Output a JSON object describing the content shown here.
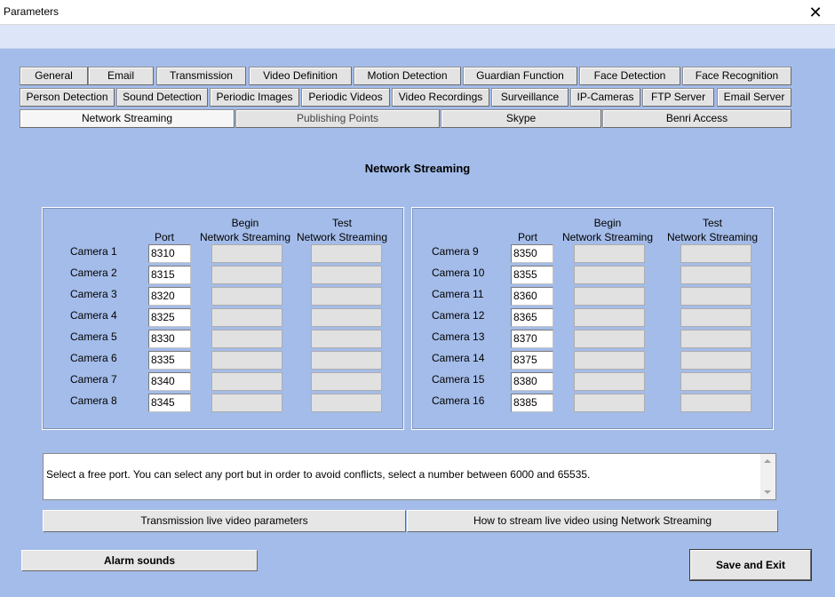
{
  "window": {
    "title": "Parameters",
    "close_glyph": "✕"
  },
  "tabs_row1": [
    "General",
    "Email",
    "Transmission",
    "Video Definition",
    "Motion Detection",
    "Guardian Function",
    "Face Detection",
    "Face Recognition"
  ],
  "tabs_row2": [
    "Person Detection",
    "Sound Detection",
    "Periodic Images",
    "Periodic Videos",
    "Video Recordings",
    "Surveillance",
    "IP-Cameras",
    "FTP Server",
    "Email Server"
  ],
  "tabs_row3": [
    "Network Streaming",
    "Publishing Points",
    "Skype",
    "Benri Access"
  ],
  "active_tab": "Network Streaming",
  "heading": "Network Streaming",
  "columns": {
    "port": "Port",
    "begin_line1": "Begin",
    "begin_line2": "Network Streaming",
    "test_line1": "Test",
    "test_line2": "Network Streaming"
  },
  "cameras_left": [
    {
      "label": "Camera 1",
      "port": "8310"
    },
    {
      "label": "Camera 2",
      "port": "8315"
    },
    {
      "label": "Camera 3",
      "port": "8320"
    },
    {
      "label": "Camera 4",
      "port": "8325"
    },
    {
      "label": "Camera 5",
      "port": "8330"
    },
    {
      "label": "Camera 6",
      "port": "8335"
    },
    {
      "label": "Camera 7",
      "port": "8340"
    },
    {
      "label": "Camera 8",
      "port": "8345"
    }
  ],
  "cameras_right": [
    {
      "label": "Camera 9",
      "port": "8350"
    },
    {
      "label": "Camera 10",
      "port": "8355"
    },
    {
      "label": "Camera 11",
      "port": "8360"
    },
    {
      "label": "Camera 12",
      "port": "8365"
    },
    {
      "label": "Camera 13",
      "port": "8370"
    },
    {
      "label": "Camera 14",
      "port": "8375"
    },
    {
      "label": "Camera 15",
      "port": "8380"
    },
    {
      "label": "Camera 16",
      "port": "8385"
    }
  ],
  "info_text": "Select a free port.  You can select any port but in order to avoid conflicts, select a number between 6000 and 65535.",
  "buttons": {
    "transmission_params": "Transmission live video parameters",
    "how_to_stream": "How to stream live video using Network Streaming",
    "alarm_sounds": "Alarm sounds",
    "save_exit": "Save and Exit"
  },
  "colors": {
    "background": "#a4bce9",
    "menustrip": "#dde6f8",
    "button_face": "#e3e3e3"
  }
}
